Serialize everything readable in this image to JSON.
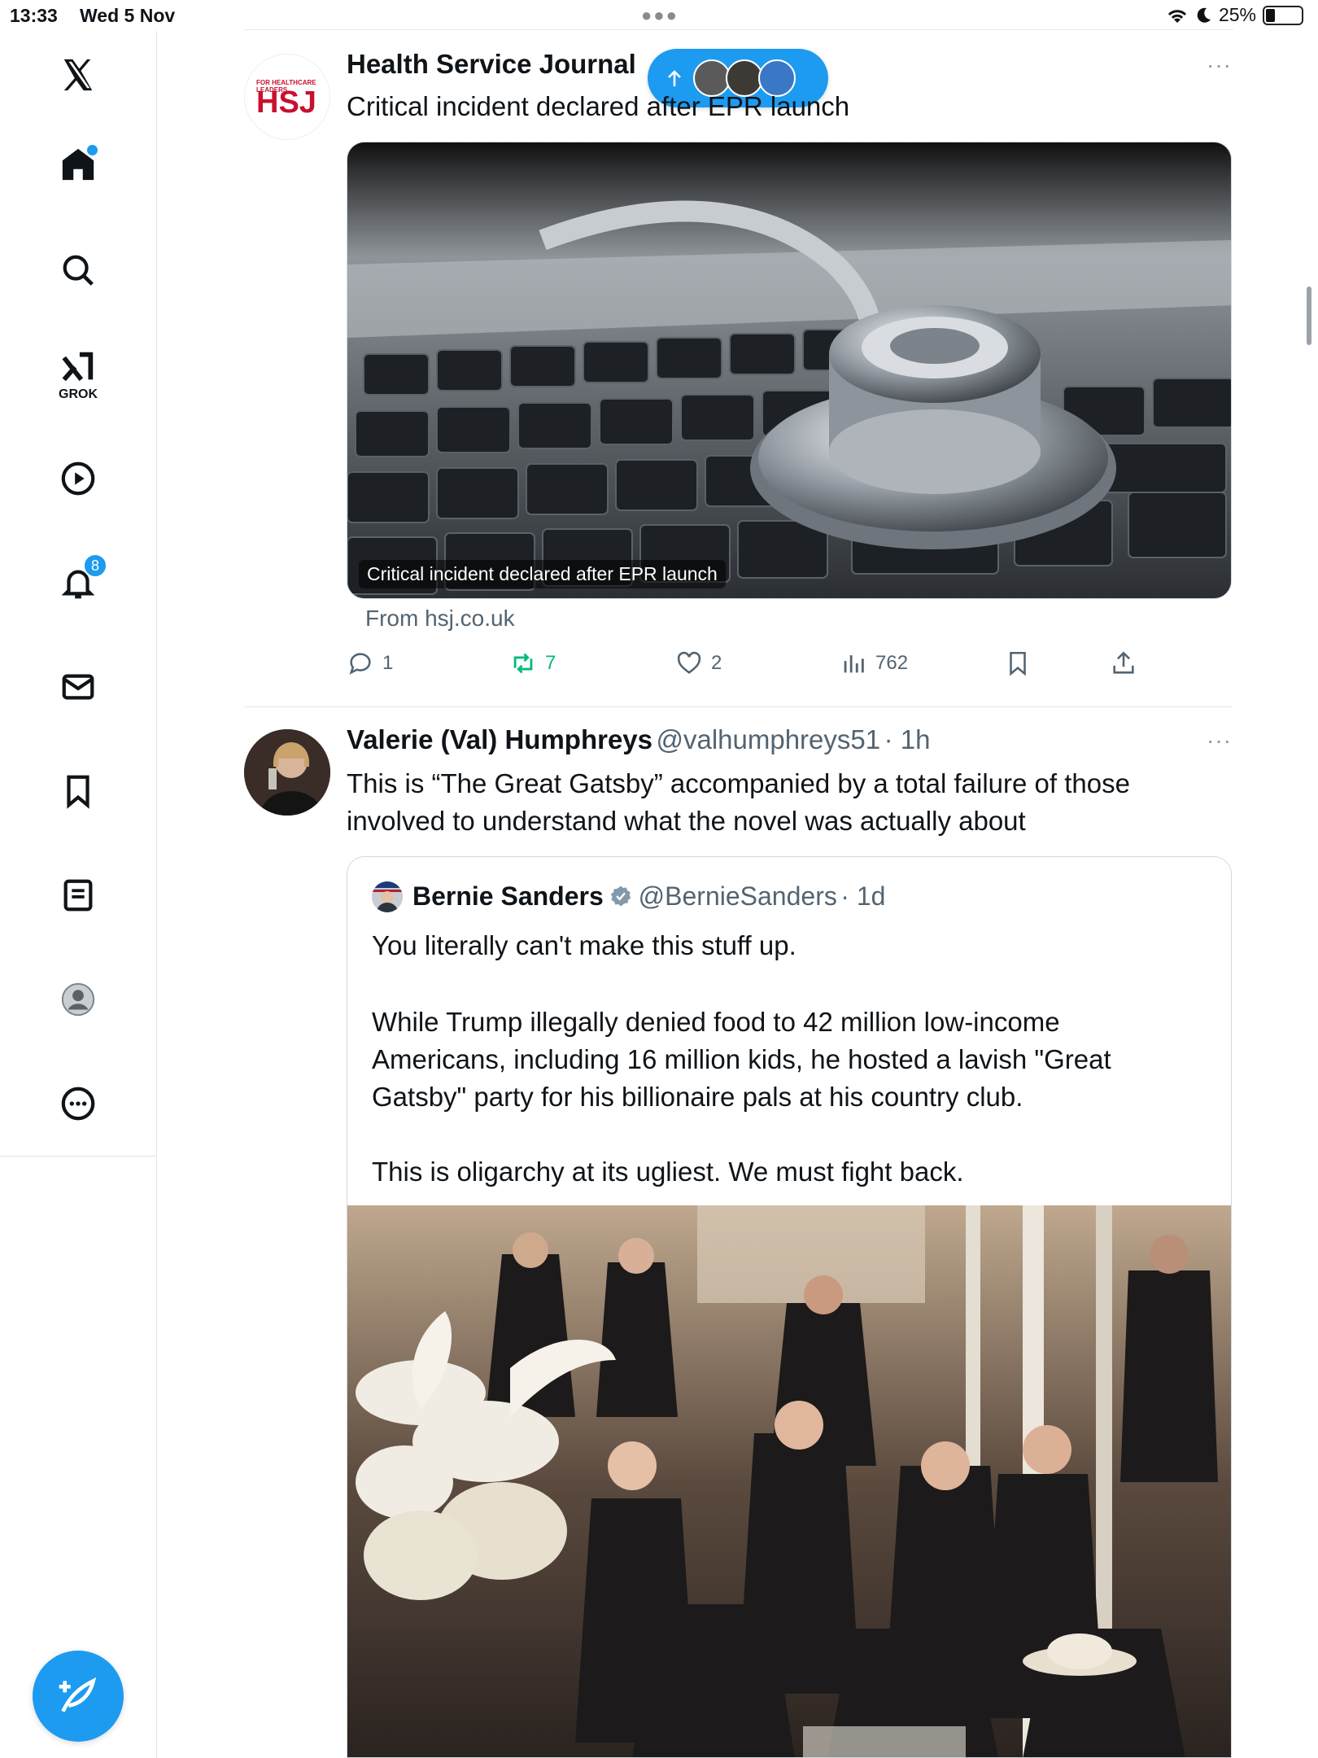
{
  "status": {
    "time": "13:33",
    "date": "Wed 5 Nov",
    "battery": "25%",
    "battery_level": 0.25
  },
  "sidebar": {
    "grok_label": "GROK",
    "notifications_badge": "8"
  },
  "new_posts_pill": {
    "icon": "arrow-up-icon"
  },
  "post1": {
    "name": "Health Service Journal",
    "logo_text": "HSJ",
    "logo_tagline": "FOR HEALTHCARE LEADERS",
    "text": "Critical incident declared after EPR launch",
    "media_caption": "Critical incident declared after EPR launch",
    "source": "From hsj.co.uk",
    "replies": "1",
    "reposts": "7",
    "likes": "2",
    "views": "762",
    "more": "···"
  },
  "post2": {
    "name": "Valerie (Val) Humphreys",
    "handle": "@valhumphreys51",
    "time": "· 1h",
    "text": "This is “The Great Gatsby” accompanied by a total failure of those involved to understand what the novel was actually about",
    "more": "···",
    "quote": {
      "name": "Bernie Sanders",
      "handle": "@BernieSanders",
      "time": "· 1d",
      "para1": "You literally can't make this stuff up.",
      "para2": "While Trump illegally denied food to 42 million low-income Americans, including 16 million kids, he hosted a lavish \"Great Gatsby\" party for his billionaire pals at his country club.",
      "para3": "This is oligarchy at its ugliest. We must fight back."
    }
  },
  "colors": {
    "accent": "#1d9bf0",
    "repost_active": "#00ba7c",
    "secondary_text": "#536471"
  }
}
